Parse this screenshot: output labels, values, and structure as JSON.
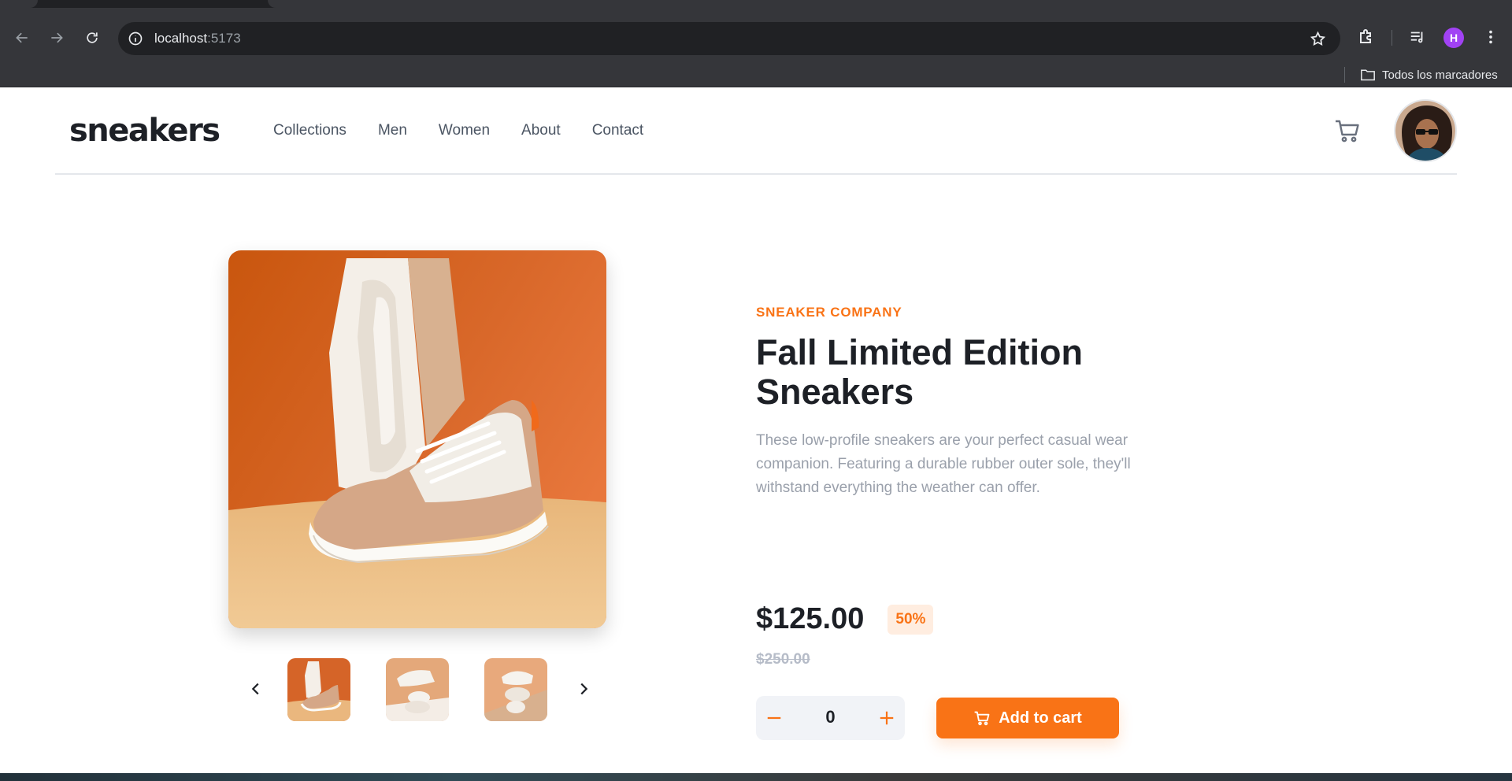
{
  "browser": {
    "url_host": "localhost",
    "url_port": ":5173",
    "profile_initial": "H",
    "bookmarks_folder": "Todos los marcadores"
  },
  "icons": {
    "back": "arrow-left-icon",
    "forward": "arrow-right-icon",
    "reload": "reload-icon",
    "site_info": "info-icon",
    "bookmark_star": "star-icon",
    "extensions": "puzzle-icon",
    "media": "media-queue-icon",
    "menu": "kebab-menu-icon",
    "folder": "folder-icon",
    "cart": "cart-icon",
    "minus": "minus-icon",
    "plus": "plus-icon",
    "prev": "chevron-left-icon",
    "next": "chevron-right-icon"
  },
  "header": {
    "logo": "sneakers",
    "nav": [
      "Collections",
      "Men",
      "Women",
      "About",
      "Contact"
    ]
  },
  "product": {
    "company": "SNEAKER COMPANY",
    "title": "Fall Limited Edition Sneakers",
    "description": "These low-profile sneakers are your perfect casual wear companion. Featuring a durable rubber outer sole, they'll withstand everything the weather can offer.",
    "price": "$125.00",
    "discount": "50%",
    "original_price": "$250.00",
    "quantity": "0",
    "add_to_cart_label": "Add to cart",
    "thumbnails_count": 3,
    "active_thumbnail": 1
  },
  "colors": {
    "accent": "#f97316",
    "accent_light": "#ffede0",
    "text_dark": "#1d2026",
    "text_muted": "#9aa0ab",
    "browser_bg": "#35363a"
  }
}
